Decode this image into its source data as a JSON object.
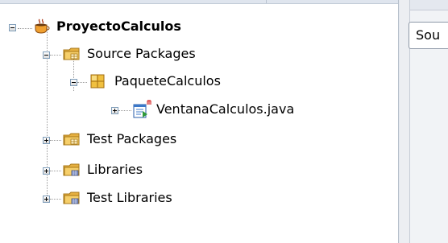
{
  "tree": {
    "project": {
      "label": "ProyectoCalculos",
      "icon": "coffee-cup-project-icon"
    },
    "source_packages": {
      "label": "Source Packages",
      "icon": "source-folder-icon"
    },
    "package": {
      "label": "PaqueteCalculos",
      "icon": "package-icon"
    },
    "java_file": {
      "label": "VentanaCalculos.java",
      "icon": "java-form-file-icon"
    },
    "test_packages": {
      "label": "Test Packages",
      "icon": "test-folder-icon"
    },
    "libraries": {
      "label": "Libraries",
      "icon": "library-folder-icon"
    },
    "test_libraries": {
      "label": "Test Libraries",
      "icon": "test-library-folder-icon"
    }
  },
  "right_tab": {
    "label": "Sou"
  },
  "colors": {
    "folder": "#f2c25a",
    "folder_dark": "#c08a1e",
    "package": "#e8b43a",
    "file": "#3c78c8",
    "accent_red": "#cc0000"
  }
}
